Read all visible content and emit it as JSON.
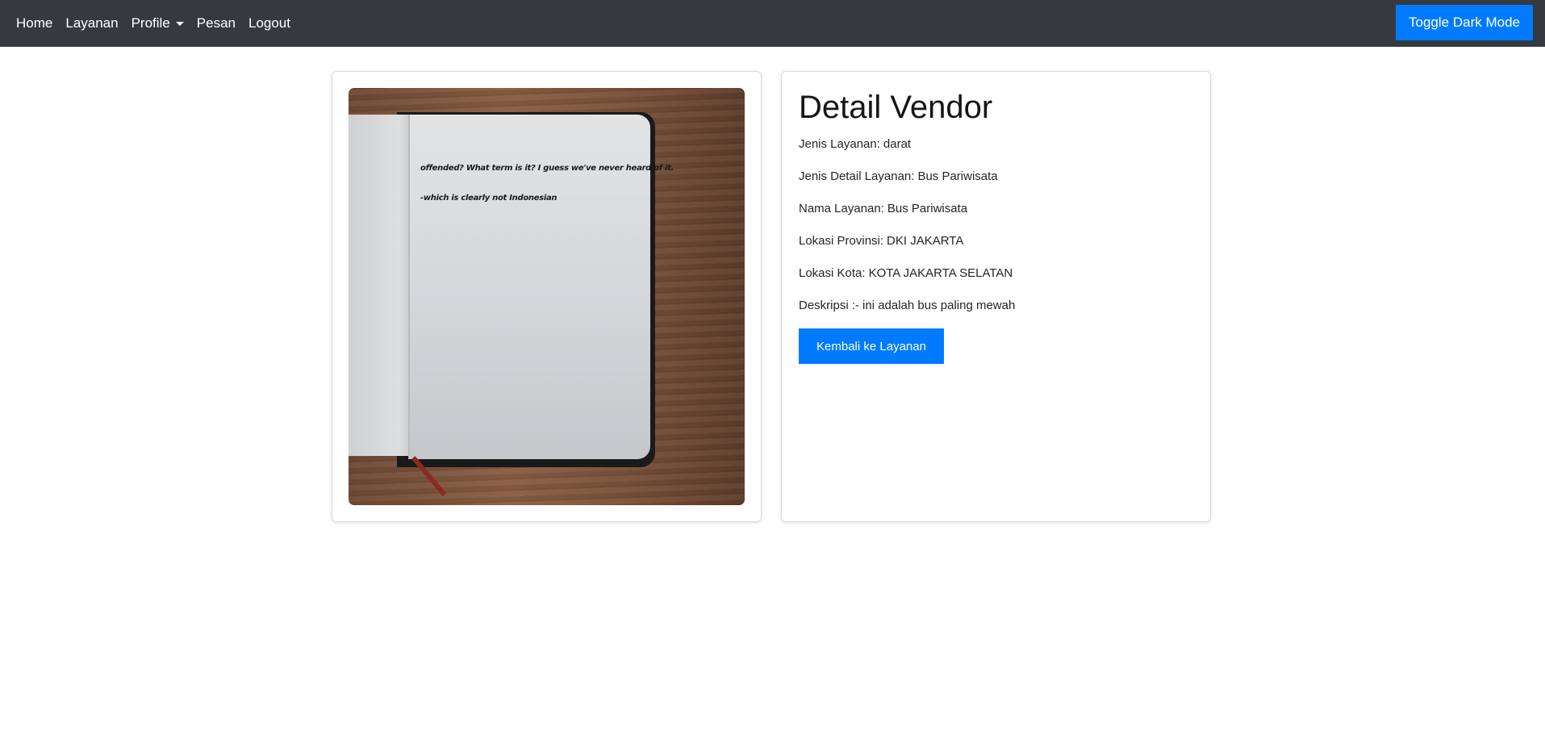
{
  "navbar": {
    "links": [
      {
        "label": "Home"
      },
      {
        "label": "Layanan"
      },
      {
        "label": "Profile"
      },
      {
        "label": "Pesan"
      },
      {
        "label": "Logout"
      }
    ],
    "toggle_label": "Toggle Dark Mode"
  },
  "image": {
    "handwriting_line1": "offended? What term is it? I guess we've never heard of it.",
    "handwriting_line2": "-which is clearly not Indonesian"
  },
  "detail": {
    "title": "Detail Vendor",
    "fields": [
      {
        "label": "Jenis Layanan:",
        "value": "darat"
      },
      {
        "label": "Jenis Detail Layanan:",
        "value": "Bus Pariwisata"
      },
      {
        "label": "Nama Layanan:",
        "value": "Bus Pariwisata"
      },
      {
        "label": "Lokasi Provinsi:",
        "value": "DKI JAKARTA"
      },
      {
        "label": "Lokasi Kota:",
        "value": "KOTA JAKARTA SELATAN"
      },
      {
        "label": "Deskripsi :-",
        "value": "ini adalah bus paling mewah"
      }
    ],
    "back_label": "Kembali ke Layanan"
  },
  "colors": {
    "navbar_bg": "#343a40",
    "primary": "#007bff"
  }
}
